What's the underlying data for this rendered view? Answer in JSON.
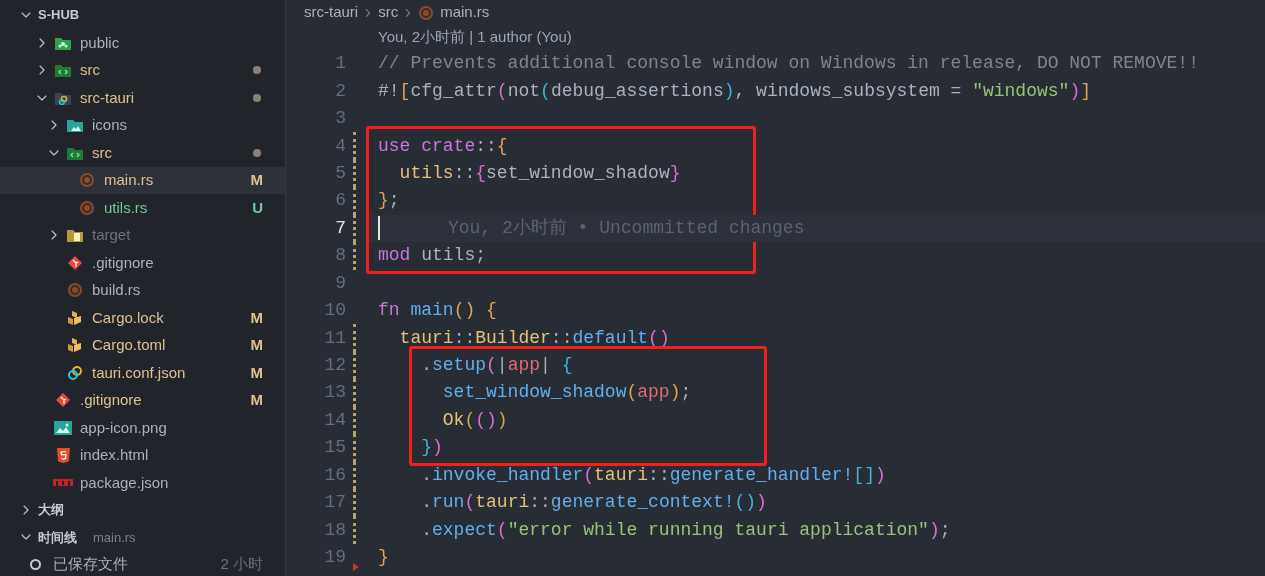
{
  "explorer": {
    "title": "S-HUB",
    "expanded": true,
    "items": [
      {
        "name": "public",
        "kind": "folder-public",
        "expanded": false,
        "selected": false,
        "color": "#a9b1bd",
        "changed": false
      },
      {
        "name": "src",
        "kind": "folder-src",
        "expanded": false,
        "selected": false,
        "color": "#e2c08d",
        "changed": true
      },
      {
        "name": "src-tauri",
        "kind": "folder-tauri",
        "expanded": true,
        "selected": false,
        "color": "#e2c08d",
        "changed": true,
        "children": [
          {
            "name": "icons",
            "kind": "folder-images",
            "expanded": false,
            "selected": false,
            "color": "#a9b1bd",
            "changed": false
          },
          {
            "name": "src",
            "kind": "folder-src",
            "expanded": true,
            "selected": false,
            "color": "#e2c08d",
            "changed": true,
            "children": [
              {
                "name": "main.rs",
                "kind": "rust",
                "selected": true,
                "color": "#e2c08d",
                "changed": false,
                "badge": "M"
              },
              {
                "name": "utils.rs",
                "kind": "rust",
                "selected": false,
                "color": "#73c991",
                "changed": false,
                "badge": "U"
              }
            ]
          },
          {
            "name": "target",
            "kind": "folder-target",
            "expanded": false,
            "selected": false,
            "color": "#6b717d",
            "changed": false
          },
          {
            "name": ".gitignore",
            "kind": "git",
            "selected": false,
            "color": "#a9b1bd",
            "changed": false
          },
          {
            "name": "build.rs",
            "kind": "rust",
            "selected": false,
            "color": "#a9b1bd",
            "changed": false
          },
          {
            "name": "Cargo.lock",
            "kind": "cargo",
            "selected": false,
            "color": "#e2c08d",
            "changed": false,
            "badge": "M"
          },
          {
            "name": "Cargo.toml",
            "kind": "cargo",
            "selected": false,
            "color": "#e2c08d",
            "changed": false,
            "badge": "M"
          },
          {
            "name": "tauri.conf.json",
            "kind": "tauri",
            "selected": false,
            "color": "#e2c08d",
            "changed": false,
            "badge": "M"
          }
        ]
      },
      {
        "name": ".gitignore",
        "kind": "git",
        "selected": false,
        "color": "#e2c08d",
        "changed": false,
        "badge": "M"
      },
      {
        "name": "app-icon.png",
        "kind": "image",
        "selected": false,
        "color": "#a9b1bd",
        "changed": false
      },
      {
        "name": "index.html",
        "kind": "html",
        "selected": false,
        "color": "#a9b1bd",
        "changed": false
      },
      {
        "name": "package.json",
        "kind": "npm",
        "selected": false,
        "color": "#a9b1bd",
        "changed": false
      }
    ]
  },
  "outline": {
    "title": "大纲",
    "expanded": false
  },
  "timeline": {
    "title": "时间线",
    "file": "main.rs",
    "expanded": true,
    "entries": [
      {
        "label": "已保存文件",
        "time": "2 小时"
      }
    ]
  },
  "breadcrumb": [
    {
      "label": "src-tauri"
    },
    {
      "label": "src"
    },
    {
      "label": "main.rs",
      "kind": "rust"
    }
  ],
  "editor": {
    "codelens": "You, 2小时前 | 1 author (You)",
    "blocks": [
      {
        "boxed": false,
        "lines": [
          {
            "number": "1",
            "kind": "none",
            "current": false,
            "tokens": [
              {
                "text": "// Prevents additional console window on Windows in release, DO NOT REMOVE!!",
                "kind": "comment"
              }
            ]
          },
          {
            "number": "2",
            "kind": "none",
            "current": false,
            "tokens": [
              {
                "text": "#!",
                "kind": "plain"
              },
              {
                "text": "[",
                "kind": "b1"
              },
              {
                "text": "cfg_attr",
                "kind": "plain"
              },
              {
                "text": "(",
                "kind": "b2"
              },
              {
                "text": "not",
                "kind": "plain"
              },
              {
                "text": "(",
                "kind": "b3"
              },
              {
                "text": "debug_assertions",
                "kind": "plain"
              },
              {
                "text": ")",
                "kind": "b3"
              },
              {
                "text": ", windows_subsystem = ",
                "kind": "plain"
              },
              {
                "text": "\"windows\"",
                "kind": "string"
              },
              {
                "text": ")",
                "kind": "b2"
              },
              {
                "text": "]",
                "kind": "b1"
              }
            ]
          },
          {
            "number": "3",
            "kind": "none",
            "current": false
          }
        ]
      },
      {
        "boxed": true,
        "lines": [
          {
            "number": "4",
            "kind": "modified",
            "current": false,
            "tokens": [
              {
                "text": "use ",
                "kind": "kw"
              },
              {
                "text": "crate",
                "kind": "kw"
              },
              {
                "text": "::",
                "kind": "plain"
              },
              {
                "text": "{",
                "kind": "b1"
              }
            ]
          },
          {
            "number": "5",
            "kind": "modified",
            "current": false,
            "tokens": [
              {
                "text": "  utils",
                "kind": "type"
              },
              {
                "text": "::",
                "kind": "plain"
              },
              {
                "text": "{",
                "kind": "b2"
              },
              {
                "text": "set_window_shadow",
                "kind": "plain"
              },
              {
                "text": "}",
                "kind": "b2"
              }
            ]
          },
          {
            "number": "6",
            "kind": "modified",
            "current": false,
            "tokens": [
              {
                "text": "}",
                "kind": "b1"
              },
              {
                "text": ";",
                "kind": "plain"
              }
            ]
          },
          {
            "number": "7",
            "kind": "modified",
            "current": true,
            "blame": "You, 2小时前 • Uncommitted changes"
          },
          {
            "number": "8",
            "kind": "modified",
            "current": false,
            "tokens": [
              {
                "text": "mod ",
                "kind": "kw"
              },
              {
                "text": "utils;",
                "kind": "plain"
              }
            ]
          }
        ]
      },
      {
        "boxed": false,
        "lines": [
          {
            "number": "9",
            "kind": "none",
            "current": false
          },
          {
            "number": "10",
            "kind": "none",
            "current": false,
            "tokens": [
              {
                "text": "fn ",
                "kind": "kw"
              },
              {
                "text": "main",
                "kind": "fn"
              },
              {
                "text": "() ",
                "kind": "b1"
              },
              {
                "text": "{",
                "kind": "b1"
              }
            ]
          },
          {
            "number": "11",
            "kind": "modified",
            "current": false,
            "tokens": [
              {
                "text": "  tauri",
                "kind": "type"
              },
              {
                "text": "::",
                "kind": "plain"
              },
              {
                "text": "Builder",
                "kind": "type"
              },
              {
                "text": "::",
                "kind": "plain"
              },
              {
                "text": "default",
                "kind": "fn"
              },
              {
                "text": "()",
                "kind": "b2"
              }
            ]
          }
        ]
      },
      {
        "boxed": true,
        "lines": [
          {
            "number": "12",
            "kind": "modified",
            "current": false,
            "tokens": [
              {
                "text": "    .",
                "kind": "plain"
              },
              {
                "text": "setup",
                "kind": "fn"
              },
              {
                "text": "(",
                "kind": "b2"
              },
              {
                "text": "|",
                "kind": "plain"
              },
              {
                "text": "app",
                "kind": "var"
              },
              {
                "text": "| ",
                "kind": "plain"
              },
              {
                "text": "{",
                "kind": "b3"
              }
            ]
          },
          {
            "number": "13",
            "kind": "modified",
            "current": false,
            "tokens": [
              {
                "text": "      set_window_shadow",
                "kind": "fn"
              },
              {
                "text": "(",
                "kind": "b1"
              },
              {
                "text": "app",
                "kind": "var"
              },
              {
                "text": ")",
                "kind": "b1"
              },
              {
                "text": ";",
                "kind": "plain"
              }
            ]
          },
          {
            "number": "14",
            "kind": "modified",
            "current": false,
            "tokens": [
              {
                "text": "      Ok",
                "kind": "type"
              },
              {
                "text": "(",
                "kind": "b1"
              },
              {
                "text": "()",
                "kind": "b2"
              },
              {
                "text": ")",
                "kind": "b1"
              }
            ]
          },
          {
            "number": "15",
            "kind": "modified",
            "current": false,
            "tokens": [
              {
                "text": "    }",
                "kind": "b3"
              },
              {
                "text": ")",
                "kind": "b2"
              }
            ]
          }
        ]
      },
      {
        "boxed": false,
        "lines": [
          {
            "number": "16",
            "kind": "modified",
            "current": false,
            "tokens": [
              {
                "text": "    .",
                "kind": "plain"
              },
              {
                "text": "invoke_handler",
                "kind": "fn"
              },
              {
                "text": "(",
                "kind": "b2"
              },
              {
                "text": "tauri",
                "kind": "type"
              },
              {
                "text": "::",
                "kind": "plain"
              },
              {
                "text": "generate_handler!",
                "kind": "fn"
              },
              {
                "text": "[]",
                "kind": "b3"
              },
              {
                "text": ")",
                "kind": "b2"
              }
            ]
          },
          {
            "number": "17",
            "kind": "modified",
            "current": false,
            "tokens": [
              {
                "text": "    .",
                "kind": "plain"
              },
              {
                "text": "run",
                "kind": "fn"
              },
              {
                "text": "(",
                "kind": "b2"
              },
              {
                "text": "tauri",
                "kind": "type"
              },
              {
                "text": "::",
                "kind": "plain"
              },
              {
                "text": "generate_context!",
                "kind": "fn"
              },
              {
                "text": "()",
                "kind": "b3"
              },
              {
                "text": ")",
                "kind": "b2"
              }
            ]
          },
          {
            "number": "18",
            "kind": "modified",
            "current": false,
            "tokens": [
              {
                "text": "    .",
                "kind": "plain"
              },
              {
                "text": "expect",
                "kind": "fn"
              },
              {
                "text": "(",
                "kind": "b2"
              },
              {
                "text": "\"error while running tauri application\"",
                "kind": "string"
              },
              {
                "text": ")",
                "kind": "b2"
              },
              {
                "text": ";",
                "kind": "plain"
              }
            ]
          },
          {
            "number": "19",
            "kind": "deleted",
            "current": false,
            "tokens": [
              {
                "text": "}",
                "kind": "b1"
              }
            ]
          }
        ]
      }
    ]
  }
}
